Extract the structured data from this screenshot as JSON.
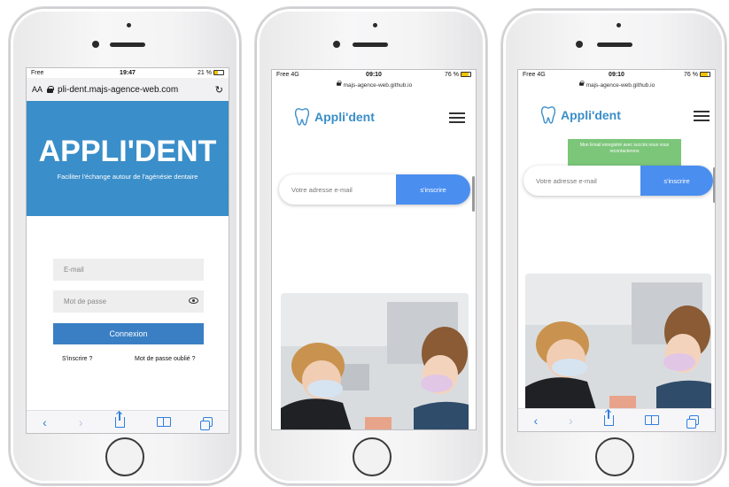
{
  "phone1": {
    "status": {
      "carrier": "Free",
      "time": "19:47",
      "battery": "21 %"
    },
    "browser": {
      "text_size": "AA",
      "url": "pli-dent.majs-agence-web.com"
    },
    "hero": {
      "title": "APPLI'DENT",
      "tagline": "Faciliter l'échange autour de l'agénésie dentaire"
    },
    "form": {
      "email_placeholder": "E-mail",
      "password_placeholder": "Mot de passe",
      "login_button": "Connexion",
      "signup_link": "S'inscrire ?",
      "forgot_link": "Mot de passe oublié ?"
    }
  },
  "phone2": {
    "status": {
      "carrier": "Free 4G",
      "time": "09:10",
      "battery": "76 %"
    },
    "browser": {
      "url": "majs-agence-web.github.io"
    },
    "brand": "Appli'dent",
    "newsletter": {
      "placeholder": "Votre adresse e-mail",
      "button": "s'inscrire"
    }
  },
  "phone3": {
    "status": {
      "carrier": "Free 4G",
      "time": "09:10",
      "battery": "76 %"
    },
    "browser": {
      "url": "majs-agence-web.github.io"
    },
    "brand": "Appli'dent",
    "toast": "Mon Email enregistré avec succès nous vous recontacterons",
    "newsletter": {
      "placeholder": "Votre adresse e-mail",
      "button": "s'inscrire"
    }
  },
  "colors": {
    "brand_blue": "#3a8ec9",
    "button_blue": "#4a8ef0",
    "toast_green": "#7cc67a",
    "safari_blue": "#2f7fe0"
  }
}
